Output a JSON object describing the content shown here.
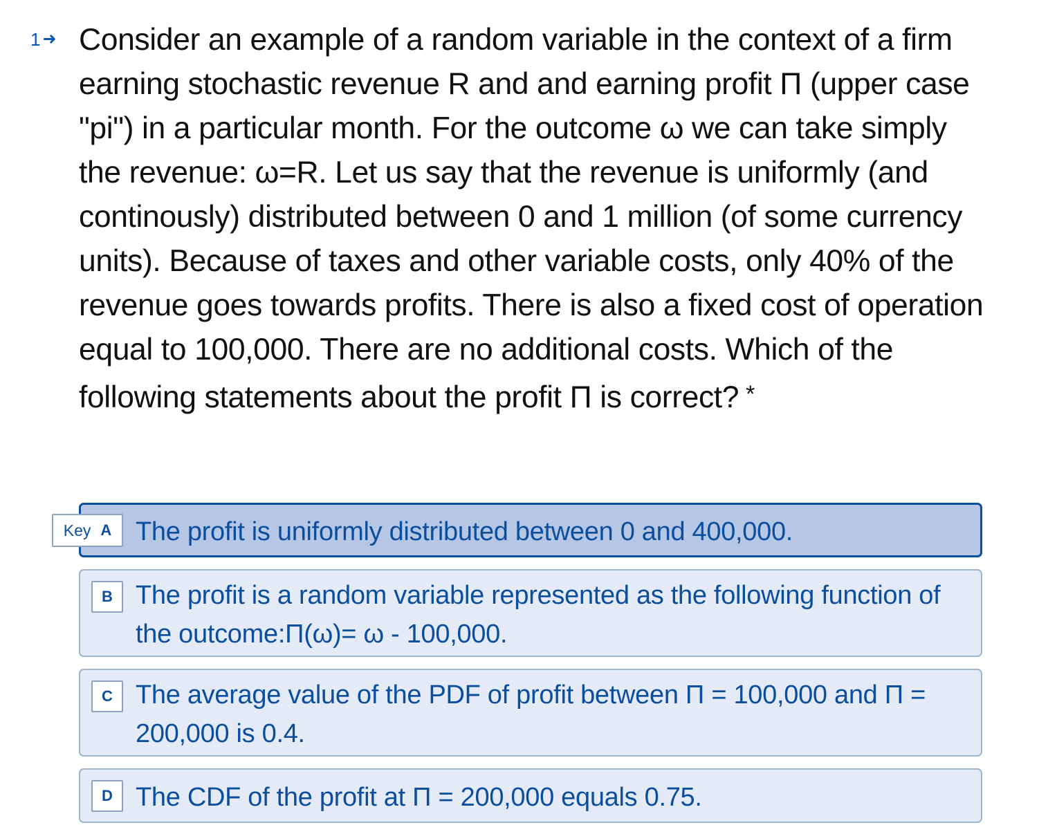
{
  "question": {
    "number": "1",
    "arrow_icon": "right-arrow-icon",
    "text": "Consider an example of a random variable in the context of a firm earning stochastic revenue R and and earning profit Π (upper case \"pi\") in a particular month. For the outcome ω we can take simply the revenue: ω=R. Let us say that the revenue is uniformly (and continously) distributed between 0 and 1 million (of some currency units). Because of taxes and other variable costs, only 40% of the revenue goes towards profits. There is also a fixed cost of operation equal to 100,000. There are no additional costs. Which of the following statements about the profit Π is correct?",
    "required_marker": "*"
  },
  "choices": [
    {
      "key_label": "Key",
      "letter": "A",
      "text": "The profit is uniformly distributed between 0 and 400,000.",
      "selected": true
    },
    {
      "letter": "B",
      "text": "The profit is a random variable represented as the following function of the outcome:Π(ω)= ω - 100,000.",
      "selected": false
    },
    {
      "letter": "C",
      "text": "The average value of the PDF of profit between Π = 100,000 and Π = 200,000 is 0.4.",
      "selected": false
    },
    {
      "letter": "D",
      "text": "The CDF of the profit at Π = 200,000 equals 0.75.",
      "selected": false
    }
  ],
  "colors": {
    "accent": "#0b4e9e",
    "choice_background": "#e4ebf7",
    "choice_selected_background": "#b6c7e6",
    "question_text": "#111111"
  }
}
